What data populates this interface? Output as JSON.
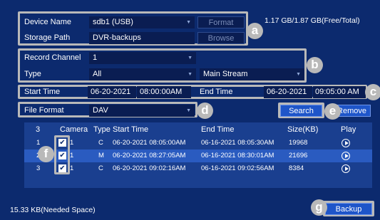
{
  "storage": {
    "device_name_label": "Device Name",
    "device_name_value": "sdb1 (USB)",
    "format_button": "Format",
    "capacity_text": "1.17 GB/1.87 GB(Free/Total)",
    "storage_path_label": "Storage Path",
    "storage_path_value": "DVR-backups",
    "browse_button": "Browse"
  },
  "record": {
    "channel_label": "Record Channel",
    "channel_value": "1",
    "type_label": "Type",
    "type_value": "All",
    "stream_value": "Main Stream"
  },
  "time": {
    "start_label": "Start Time",
    "start_date": "06-20-2021",
    "start_clock": "08:00:00AM",
    "end_label": "End Time",
    "end_date": "06-20-2021",
    "end_clock": "09:05:00 AM"
  },
  "format": {
    "file_format_label": "File Format",
    "file_format_value": "DAV",
    "search_button": "Search",
    "remove_button": "Remove"
  },
  "table": {
    "headers": [
      "3",
      "Camera",
      "Type",
      "Start Time",
      "End Time",
      "Size(KB)",
      "Play"
    ],
    "rows": [
      {
        "index": "1",
        "camera": "1",
        "type": "C",
        "start": "06-20-2021 08:05:00AM",
        "end": "06-16-2021 08:05:30AM",
        "size": "19968"
      },
      {
        "index": "2",
        "camera": "1",
        "type": "M",
        "start": "06-20-2021 08:27:05AM",
        "end": "06-16-2021 08:30:01AM",
        "size": "21696"
      },
      {
        "index": "3",
        "camera": "1",
        "type": "C",
        "start": "06-20-2021 09:02:16AM",
        "end": "06-16-2021 09:02:56AM",
        "size": "8384"
      }
    ]
  },
  "footer": {
    "needed_space": "15.33 KB(Needed Space)",
    "backup_button": "Backup"
  },
  "callouts": [
    "a",
    "b",
    "c",
    "d",
    "e",
    "f",
    "g"
  ],
  "colors": {
    "background": "#0c2a6e",
    "field": "#0a1d52",
    "accent_button": "#1e55c9",
    "callout": "#b9b9b9",
    "selected_row": "#2a5bc0"
  }
}
